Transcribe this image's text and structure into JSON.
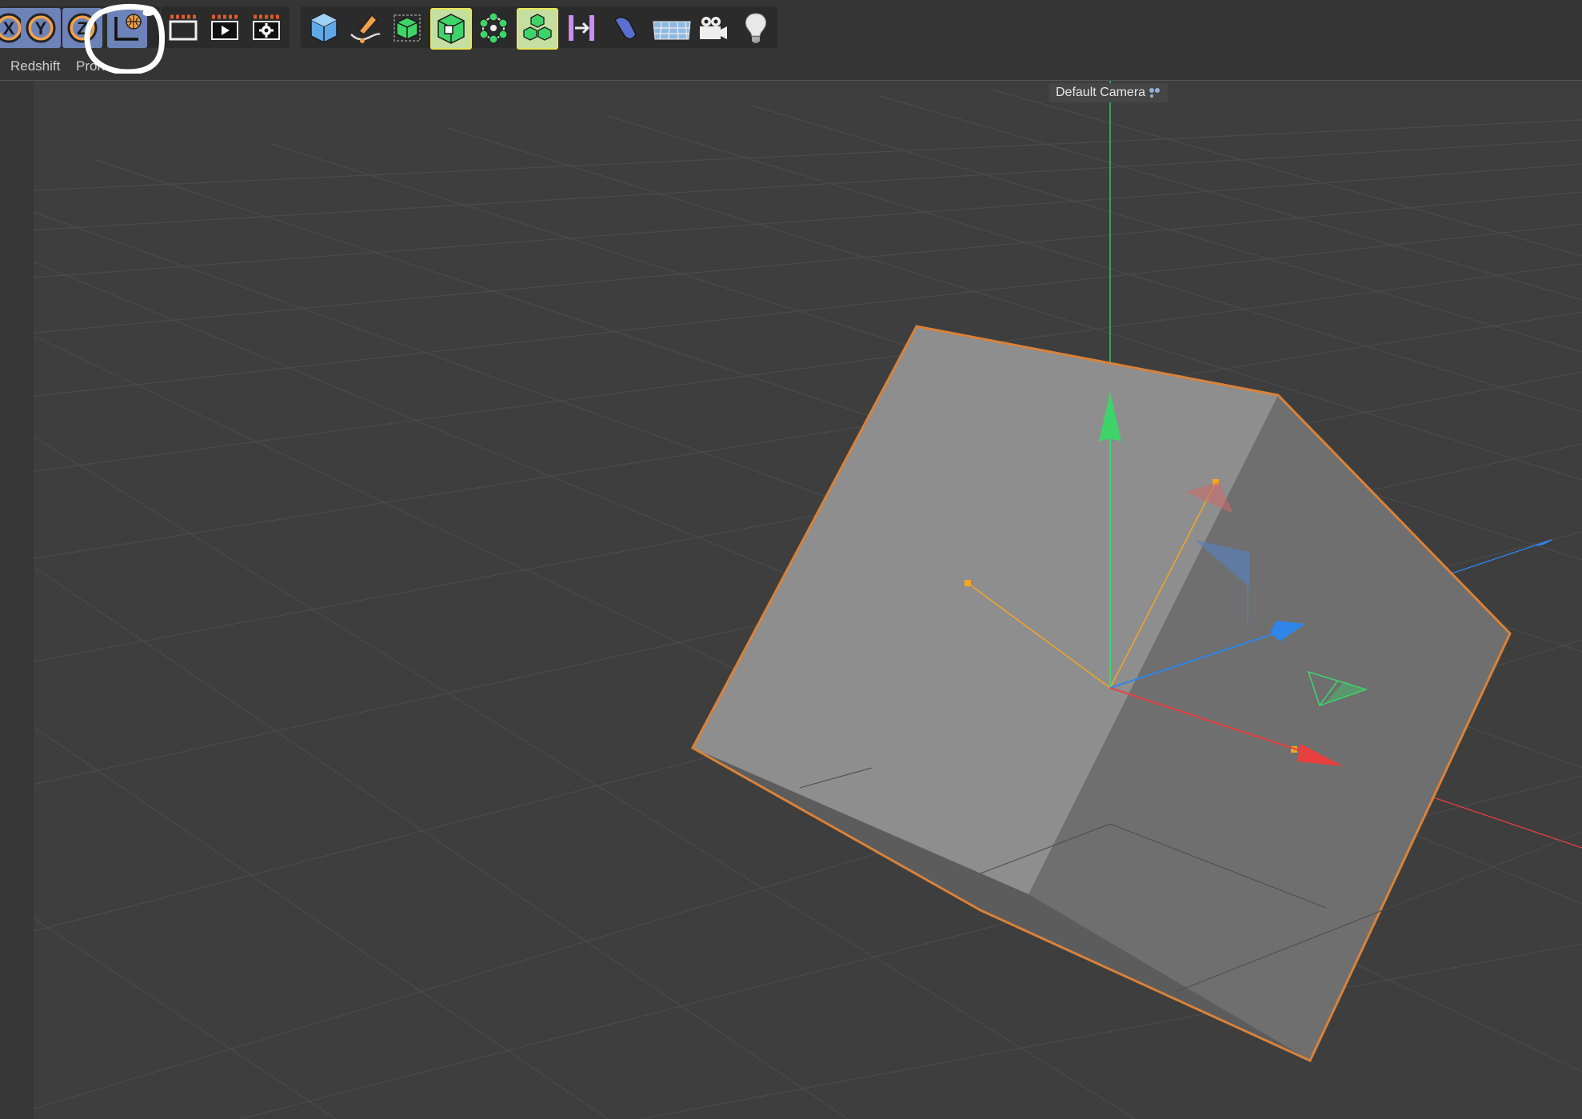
{
  "toolbar": {
    "buttons": [
      {
        "name": "x-axis-lock-button",
        "icon": "x-axis-icon",
        "label": "X"
      },
      {
        "name": "y-axis-lock-button",
        "icon": "y-axis-icon",
        "label": "Y"
      },
      {
        "name": "z-axis-lock-button",
        "icon": "z-axis-icon",
        "label": "Z"
      },
      {
        "name": "world-coordinate-button",
        "icon": "world-coordinates-icon"
      },
      {
        "name": "render-view-button",
        "icon": "render-view-icon"
      },
      {
        "name": "render-to-picture-viewer-button",
        "icon": "render-picture-viewer-icon"
      },
      {
        "name": "render-settings-button",
        "icon": "render-settings-icon"
      },
      {
        "name": "cube-object-button",
        "icon": "cube-icon"
      },
      {
        "name": "pen-spline-button",
        "icon": "pen-spline-icon"
      },
      {
        "name": "subdivision-surface-button",
        "icon": "subdivision-surface-icon"
      },
      {
        "name": "extrude-generator-button",
        "icon": "extrude-icon"
      },
      {
        "name": "cloner-button",
        "icon": "cloner-icon"
      },
      {
        "name": "array-button",
        "icon": "array-icon"
      },
      {
        "name": "bend-deformer-button",
        "icon": "bend-deformer-icon"
      },
      {
        "name": "floor-button",
        "icon": "floor-icon"
      },
      {
        "name": "camera-button",
        "icon": "camera-icon"
      },
      {
        "name": "light-button",
        "icon": "light-bulb-icon"
      }
    ]
  },
  "menu": {
    "items": [
      "Redshift",
      "Pron"
    ]
  },
  "viewport": {
    "camera_label": "Default Camera",
    "camera_icon": "camera-dots-icon",
    "colors": {
      "background": "#3e3e3e",
      "grid": "#4a4a4a",
      "selection_outline": "#d9823a",
      "axis_x": "#e84040",
      "axis_y": "#3fd46a",
      "axis_z": "#2f86e8",
      "handle": "#f5a623"
    }
  },
  "annotation": {
    "shape": "hand-drawn-circle",
    "color": "#ffffff"
  }
}
